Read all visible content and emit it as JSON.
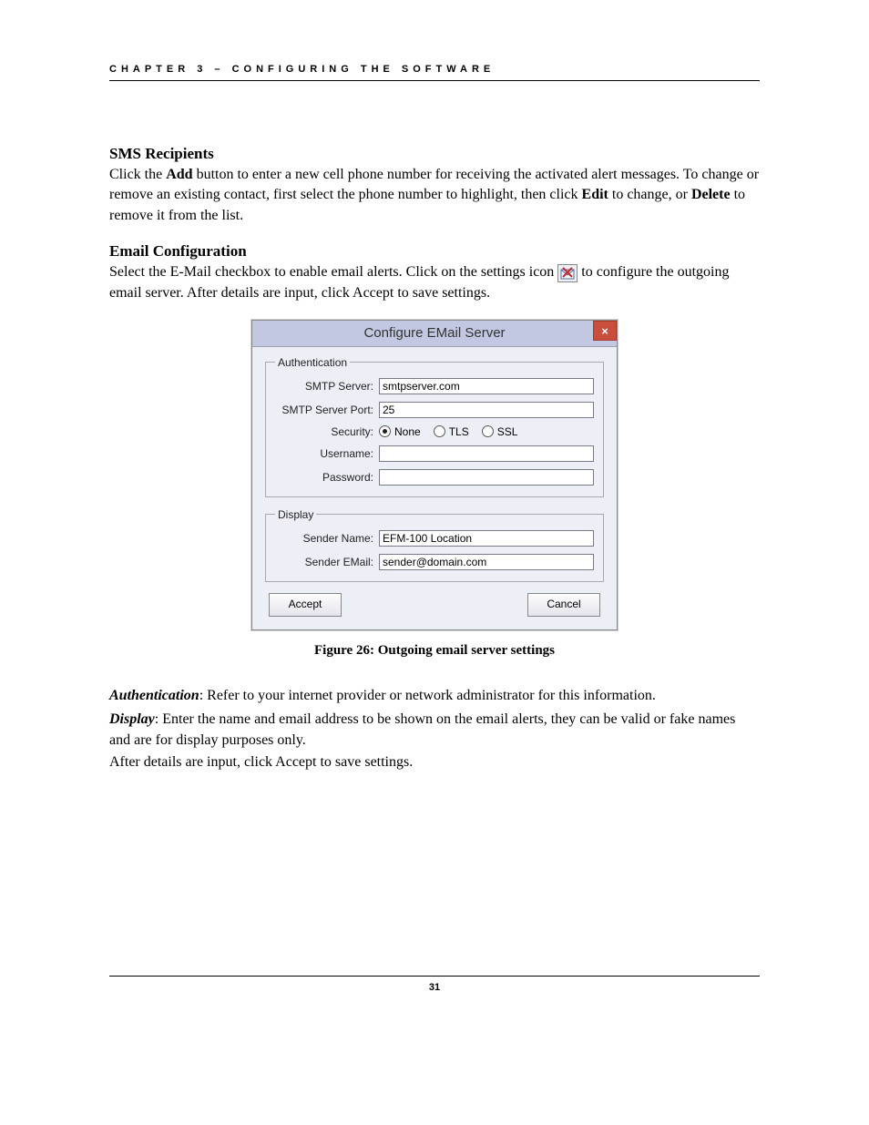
{
  "header": {
    "chapter_line": "CHAPTER 3 – CONFIGURING THE SOFTWARE"
  },
  "sections": {
    "sms_heading": "SMS Recipients",
    "sms_p1_a": "Click the ",
    "sms_p1_add": "Add",
    "sms_p1_b": " button to enter a new cell phone number for receiving the activated alert messages. To change or remove an existing contact, first select the phone number to highlight, then click ",
    "sms_p1_edit": "Edit",
    "sms_p1_c": " to change, or ",
    "sms_p1_delete": "Delete",
    "sms_p1_d": " to remove it from the list.",
    "email_heading": "Email Configuration",
    "email_p1_a": "Select the E-Mail checkbox to enable email alerts. Click on the settings icon ",
    "email_p1_b": " to configure the outgoing email server. After details are input, click Accept to save settings."
  },
  "dialog": {
    "title": "Configure EMail Server",
    "close_glyph": "×",
    "authentication": {
      "legend": "Authentication",
      "smtp_server_label": "SMTP Server:",
      "smtp_server_value": "smtpserver.com",
      "smtp_port_label": "SMTP Server Port:",
      "smtp_port_value": "25",
      "security_label": "Security:",
      "security_options": {
        "none": "None",
        "tls": "TLS",
        "ssl": "SSL"
      },
      "security_selected": "none",
      "username_label": "Username:",
      "username_value": "",
      "password_label": "Password:",
      "password_value": ""
    },
    "display": {
      "legend": "Display",
      "sender_name_label": "Sender Name:",
      "sender_name_value": "EFM-100 Location",
      "sender_email_label": "Sender EMail:",
      "sender_email_value": "sender@domain.com"
    },
    "buttons": {
      "accept": "Accept",
      "cancel": "Cancel"
    }
  },
  "caption": "Figure 26: Outgoing email server settings",
  "after": {
    "auth_label": "Authentication",
    "auth_rest": ": Refer to your internet provider or network administrator for this information.",
    "display_label": "Display",
    "display_rest": ": Enter the name and email address to be shown on the email alerts, they can be valid or fake names and are for display purposes only.",
    "final_line": "After details are input, click Accept to save settings."
  },
  "page_number": "31"
}
